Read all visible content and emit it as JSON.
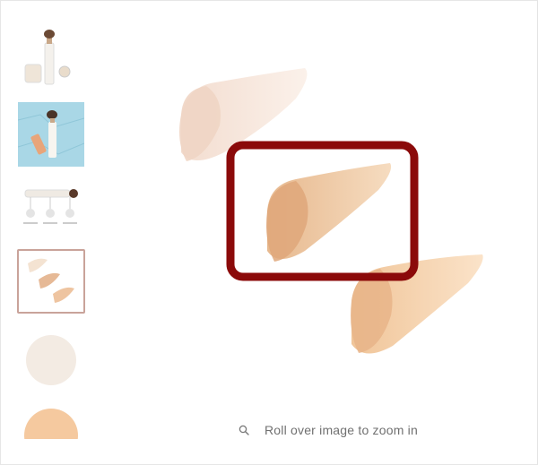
{
  "gallery": {
    "thumbnails": [
      {
        "name": "product-brush-kit",
        "selected": false
      },
      {
        "name": "product-on-blue",
        "selected": false
      },
      {
        "name": "shade-diagram",
        "selected": false
      },
      {
        "name": "swatches",
        "selected": true
      },
      {
        "name": "ivory-circle",
        "selected": false
      },
      {
        "name": "peach-circle",
        "selected": false
      }
    ]
  },
  "zoom_hint": {
    "text": "Roll over image to zoom in",
    "icon": "search-icon"
  },
  "colors": {
    "highlight_box": "#8b0a0a",
    "selected_thumb_border": "#c9a39a"
  }
}
